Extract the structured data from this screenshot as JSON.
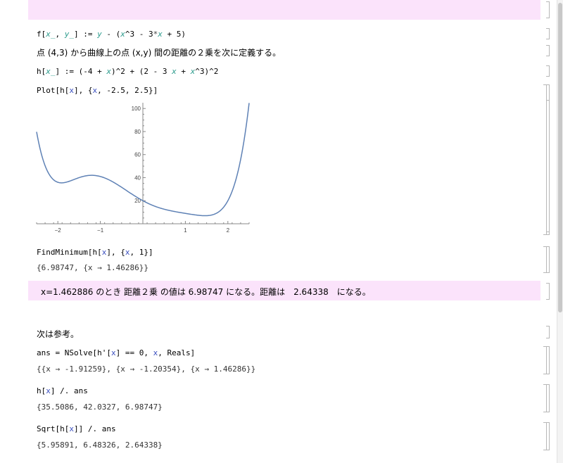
{
  "cells": {
    "def_f": {
      "head": "f[",
      "x": "x_",
      "comma": ",",
      "y": "y_",
      "mid": "] := ",
      "yv": "y",
      "rest1": " - (",
      "xv": "x",
      "rest2": "^3 - 3",
      "star": "*",
      "xv2": "x",
      "rest3": " + 5)"
    },
    "comment_dist": "点 (4,3) から曲線上の点 (x,y) 間の距離の２乗を次に定義する。",
    "def_h": {
      "head": "h[",
      "x": "x_",
      "mid": "] := (-4 + ",
      "xv": "x",
      "rest1": ")^2 + (2 - 3 ",
      "xv2": "x",
      "rest2": " + ",
      "xv3": "x",
      "rest3": "^3)^2"
    },
    "plot_cmd": {
      "head": "Plot[h[",
      "xv": "x",
      "mid": "], {",
      "xv2": "x",
      "rest": ", -2.5, 2.5}]"
    },
    "findmin_cmd": {
      "head": "FindMinimum[h[",
      "xv": "x",
      "mid": "], {",
      "xv2": "x",
      "rest": ", 1}]"
    },
    "findmin_out": "{6.98747, {x → 1.46286}}",
    "result_text": "x=1.462886 のとき 距離２乗 の値は 6.98747 になる。距離は　2.64338　になる。",
    "reference": "次は参考。",
    "nsolve_cmd": {
      "head": "ans = NSolve[h'[",
      "xv": "x",
      "mid": "] == 0, ",
      "xv2": "x",
      "rest": ", Reals]"
    },
    "nsolve_out": "{{x → -1.91259}, {x → -1.20354}, {x → 1.46286}}",
    "replace_cmd": {
      "head": "h[",
      "xv": "x",
      "rest": "] /. ans"
    },
    "replace_out": "{35.5086, 42.0327, 6.98747}",
    "sqrt_cmd": {
      "head": "Sqrt[h[",
      "xv": "x",
      "rest": "]] /. ans"
    },
    "sqrt_out": "{5.95891, 6.48326, 2.64338}"
  },
  "colors": {
    "band": "#fbe3fb",
    "curve": "#5e81b5",
    "pattern_var": "#2b9b8c",
    "symbol": "#3a4fc0"
  },
  "chart_data": {
    "type": "line",
    "series": [
      {
        "function": "(x-4)^2 + (x^3 - 3x + 2)^2"
      }
    ],
    "x_range": [
      -2.5,
      2.5
    ],
    "ylim": [
      0,
      105
    ],
    "xticks": [
      -2,
      -1,
      1,
      2
    ],
    "xtick_labels": [
      "−2",
      "−1",
      "1",
      "2"
    ],
    "yticks": [
      20,
      40,
      60,
      80,
      100
    ],
    "ytick_labels": [
      "20",
      "40",
      "60",
      "80",
      "100"
    ],
    "grid": false
  }
}
